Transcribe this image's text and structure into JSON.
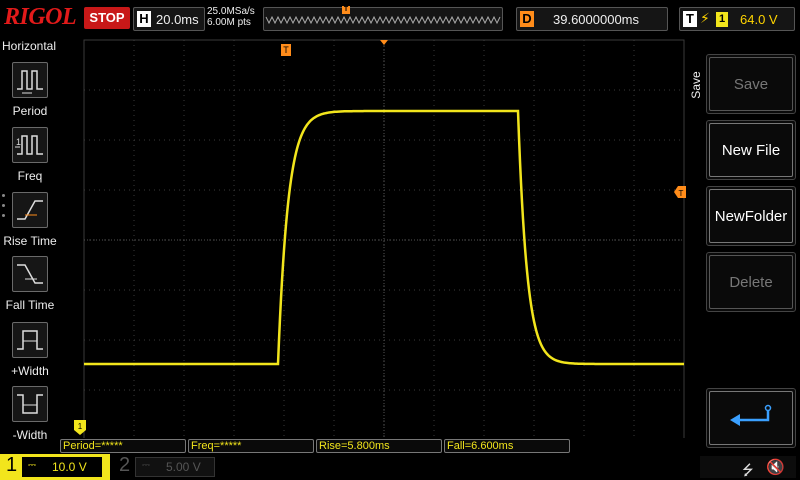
{
  "brand": {
    "logo": "RIGOL",
    "run_state": "STOP"
  },
  "horizontal": {
    "letter": "H",
    "timebase": "20.0ms",
    "sample_rate": "25.0MSa/s",
    "memory_depth": "6.00M pts"
  },
  "delay": {
    "letter": "D",
    "value": "39.6000000ms"
  },
  "trigger": {
    "letter": "T",
    "source": "1",
    "level": "64.0 V",
    "marker": "T"
  },
  "left_menu": {
    "title": "Horizontal",
    "items": [
      {
        "label": "Period"
      },
      {
        "label": "Freq"
      },
      {
        "label": "Rise Time"
      },
      {
        "label": "Fall Time"
      },
      {
        "label": "+Width"
      },
      {
        "label": "-Width"
      }
    ]
  },
  "right_menu": {
    "title": "Save",
    "buttons": [
      {
        "label": "Save",
        "enabled": false
      },
      {
        "label": "New File",
        "enabled": true
      },
      {
        "label": "NewFolder",
        "enabled": true
      },
      {
        "label": "Delete",
        "enabled": false
      }
    ]
  },
  "measurements": [
    {
      "text": "Period=*****"
    },
    {
      "text": "Freq=*****"
    },
    {
      "text": "Rise=5.800ms"
    },
    {
      "text": "Fall=6.600ms"
    }
  ],
  "channels": [
    {
      "num": "1",
      "scale": "10.0 V",
      "active": true
    },
    {
      "num": "2",
      "scale": "5.00 V",
      "active": false
    }
  ],
  "colors": {
    "ch1": "#f2e51c",
    "trigger": "#ff8c1a",
    "stop": "#c81818",
    "grid": "#3a3a3a"
  },
  "icons": {
    "usb": "usb-icon",
    "sound": "speaker-mute-icon"
  }
}
